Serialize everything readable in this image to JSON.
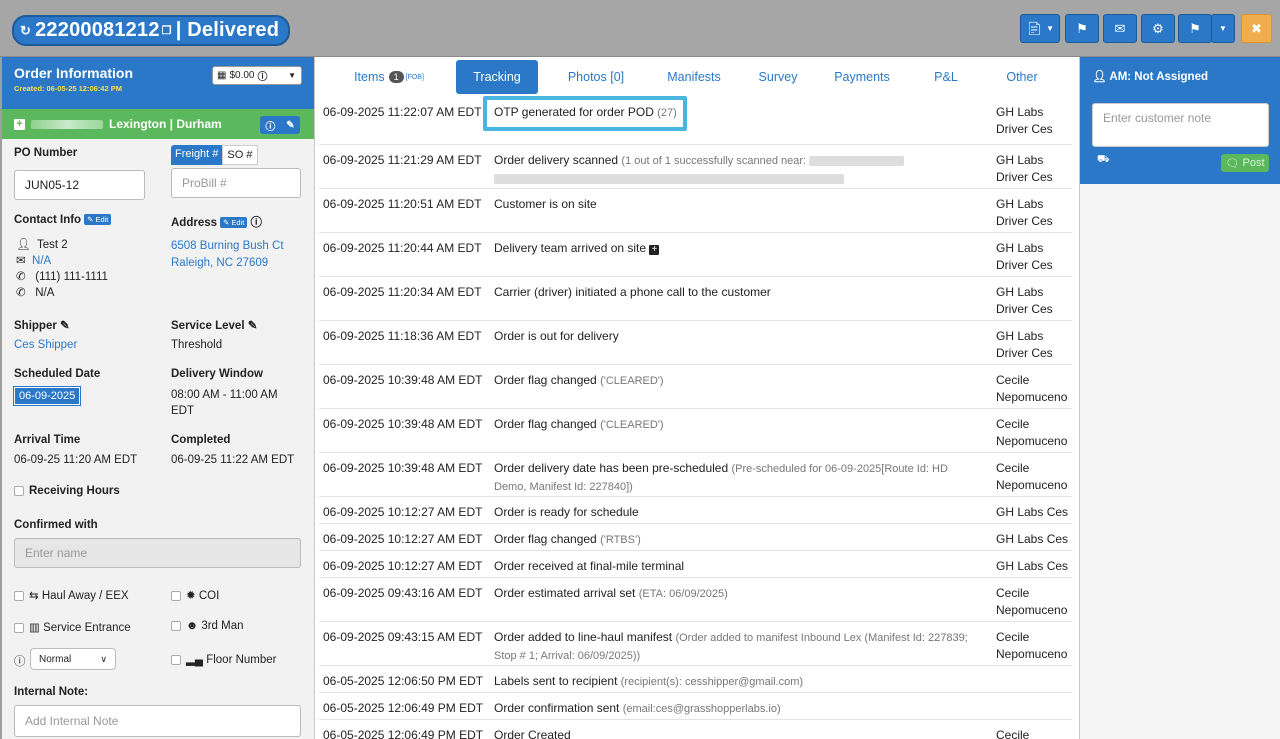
{
  "header": {
    "order_number": "22200081212",
    "status": "Delivered",
    "title_separator": "|",
    "buttons": [
      "document-icon",
      "flag-icon",
      "envelope-icon",
      "gear-icon",
      "route-icon",
      "close-icon"
    ]
  },
  "order_info": {
    "title": "Order Information",
    "created": "Created: 06-05-25 12:06:42 PM",
    "price": "$0.00",
    "terminal": "Lexington | Durham",
    "po_label": "PO Number",
    "po_value": "JUN05-12",
    "freight_tab": "Freight #",
    "so_tab": "SO #",
    "probill_placeholder": "ProBill #",
    "contact_label": "Contact Info",
    "edit": "Edit",
    "contact_name": "Test 2",
    "contact_email": "N/A",
    "contact_phone": "(111) 111-1111",
    "contact_phone2": "N/A",
    "address_label": "Address",
    "address_line1": "6508 Burning Bush Ct",
    "address_line2": "Raleigh, NC 27609",
    "shipper_label": "Shipper",
    "shipper_value": "Ces Shipper",
    "service_label": "Service Level",
    "service_value": "Threshold",
    "sched_label": "Scheduled Date",
    "sched_value": "06-09-2025",
    "window_label": "Delivery Window",
    "window_value1": "08:00 AM - 11:00 AM",
    "window_value2": "EDT",
    "arrival_label": "Arrival Time",
    "arrival_value": "06-09-25 11:20 AM EDT",
    "completed_label": "Completed",
    "completed_value": "06-09-25 11:22 AM EDT",
    "receiving_hours": "Receiving Hours",
    "confirmed_label": "Confirmed with",
    "confirmed_placeholder": "Enter name",
    "haul_away": "Haul Away / EEX",
    "coi": "COI",
    "service_entrance": "Service Entrance",
    "third_man": "3rd Man",
    "priority_value": "Normal",
    "floor_number": "Floor Number",
    "internal_note_label": "Internal Note:",
    "internal_note_placeholder": "Add Internal Note"
  },
  "tabs": {
    "items": "Items",
    "items_count": "1",
    "items_sup": "[FOB]",
    "tracking": "Tracking",
    "photos": "Photos [0]",
    "manifests": "Manifests",
    "survey": "Survey",
    "payments": "Payments",
    "pl": "P&L",
    "other": "Other"
  },
  "tracking": [
    {
      "time": "06-09-2025 11:22:07 AM EDT",
      "desc": "OTP generated for order POD",
      "detail": "(27)",
      "user1": "GH Labs",
      "user2": "Driver Ces"
    },
    {
      "time": "06-09-2025 11:21:29 AM EDT",
      "desc": "Order delivery scanned",
      "detail": "(1 out of 1 successfully scanned near:",
      "user1": "GH Labs",
      "user2": "Driver Ces"
    },
    {
      "time": "06-09-2025 11:20:51 AM EDT",
      "desc": "Customer is on site",
      "detail": "",
      "user1": "GH Labs",
      "user2": "Driver Ces"
    },
    {
      "time": "06-09-2025 11:20:44 AM EDT",
      "desc": "Delivery team arrived on site",
      "detail": "",
      "user1": "GH Labs",
      "user2": "Driver Ces"
    },
    {
      "time": "06-09-2025 11:20:34 AM EDT",
      "desc": "Carrier (driver) initiated a phone call to the customer",
      "detail": "",
      "user1": "GH Labs",
      "user2": "Driver Ces"
    },
    {
      "time": "06-09-2025 11:18:36 AM EDT",
      "desc": "Order is out for delivery",
      "detail": "",
      "user1": "GH Labs",
      "user2": "Driver Ces"
    },
    {
      "time": "06-09-2025 10:39:48 AM EDT",
      "desc": "Order flag changed",
      "detail": "('CLEARED')",
      "user1": "Cecile",
      "user2": "Nepomuceno"
    },
    {
      "time": "06-09-2025 10:39:48 AM EDT",
      "desc": "Order flag changed",
      "detail": "('CLEARED')",
      "user1": "Cecile",
      "user2": "Nepomuceno"
    },
    {
      "time": "06-09-2025 10:39:48 AM EDT",
      "desc": "Order delivery date has been pre-scheduled",
      "detail": "(Pre-scheduled for 06-09-2025[Route Id: HD",
      "detail2": "Demo, Manifest Id: 227840])",
      "user1": "Cecile",
      "user2": "Nepomuceno"
    },
    {
      "time": "06-09-2025 10:12:27 AM EDT",
      "desc": "Order is ready for schedule",
      "detail": "",
      "user1": "GH Labs Ces",
      "user2": ""
    },
    {
      "time": "06-09-2025 10:12:27 AM EDT",
      "desc": "Order flag changed",
      "detail": "('RTBS')",
      "user1": "GH Labs Ces",
      "user2": ""
    },
    {
      "time": "06-09-2025 10:12:27 AM EDT",
      "desc": "Order received at final-mile terminal",
      "detail": "",
      "user1": "GH Labs Ces",
      "user2": ""
    },
    {
      "time": "06-09-2025 09:43:16 AM EDT",
      "desc": "Order estimated arrival set",
      "detail": "(ETA: 06/09/2025)",
      "user1": "Cecile",
      "user2": "Nepomuceno"
    },
    {
      "time": "06-09-2025 09:43:15 AM EDT",
      "desc": "Order added to line-haul manifest",
      "detail": "(Order added to manifest Inbound Lex (Manifest Id: 227839;",
      "detail2": "Stop # 1; Arrival: 06/09/2025))",
      "user1": "Cecile",
      "user2": "Nepomuceno"
    },
    {
      "time": "06-05-2025 12:06:50 PM EDT",
      "desc": "Labels sent to recipient",
      "detail": "(recipient(s): cesshipper@gmail.com)",
      "user1": "",
      "user2": ""
    },
    {
      "time": "06-05-2025 12:06:49 PM EDT",
      "desc": "Order confirmation sent",
      "detail": "(email:ces@grasshopperlabs.io)",
      "user1": "",
      "user2": ""
    },
    {
      "time": "06-05-2025 12:06:49 PM EDT",
      "desc": "Order Created",
      "detail": "",
      "user1": "Cecile",
      "user2": ""
    }
  ],
  "account_manager": {
    "title": "AM: Not Assigned",
    "note_placeholder": "Enter customer note",
    "post": "Post"
  }
}
